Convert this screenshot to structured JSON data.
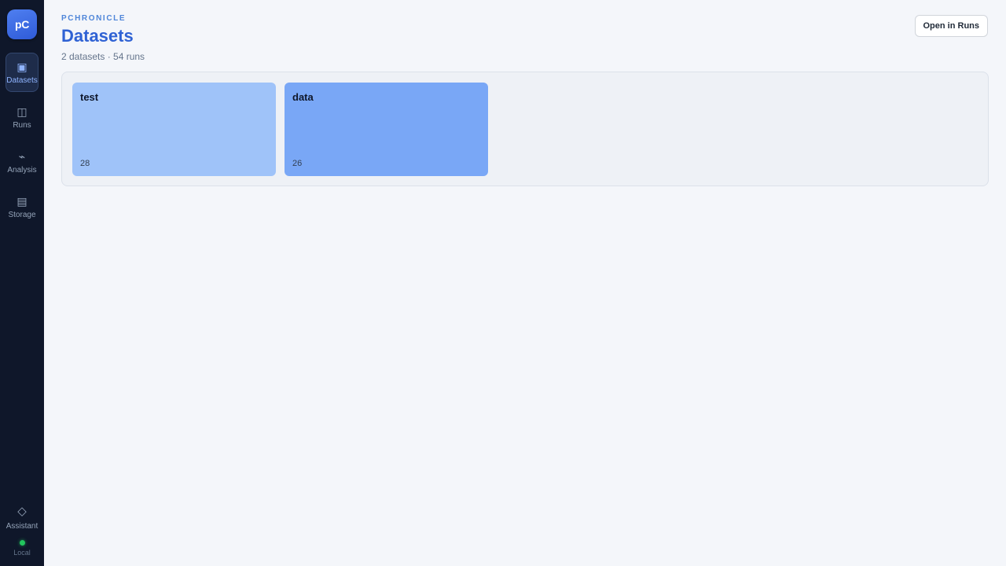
{
  "sidebar": {
    "logo_text": "pC",
    "items": [
      {
        "label": "Datasets",
        "icon": "datasets-icon",
        "glyph": "▣",
        "active": true
      },
      {
        "label": "Runs",
        "icon": "runs-icon",
        "glyph": "◫",
        "active": false
      },
      {
        "label": "Analysis",
        "icon": "analysis-icon",
        "glyph": "⌁",
        "active": false
      },
      {
        "label": "Storage",
        "icon": "storage-icon",
        "glyph": "▤",
        "active": false
      }
    ],
    "assistant": {
      "label": "Assistant",
      "icon": "assistant-icon",
      "glyph": "◇"
    },
    "status": {
      "label": "Local",
      "color": "#22c55e"
    }
  },
  "header": {
    "eyebrow": "PCHRONICLE",
    "title": "Datasets",
    "subtitle": "2 datasets · 54 runs",
    "open_runs_label": "Open in Runs"
  },
  "datasets": [
    {
      "name": "test",
      "count": "28",
      "color": "#9fc3f9"
    },
    {
      "name": "data",
      "count": "26",
      "color": "#79a7f6"
    }
  ],
  "colors": {
    "sidebar_bg": "#0f172a",
    "accent": "#2f62d4",
    "page_bg": "#f4f6fa"
  }
}
